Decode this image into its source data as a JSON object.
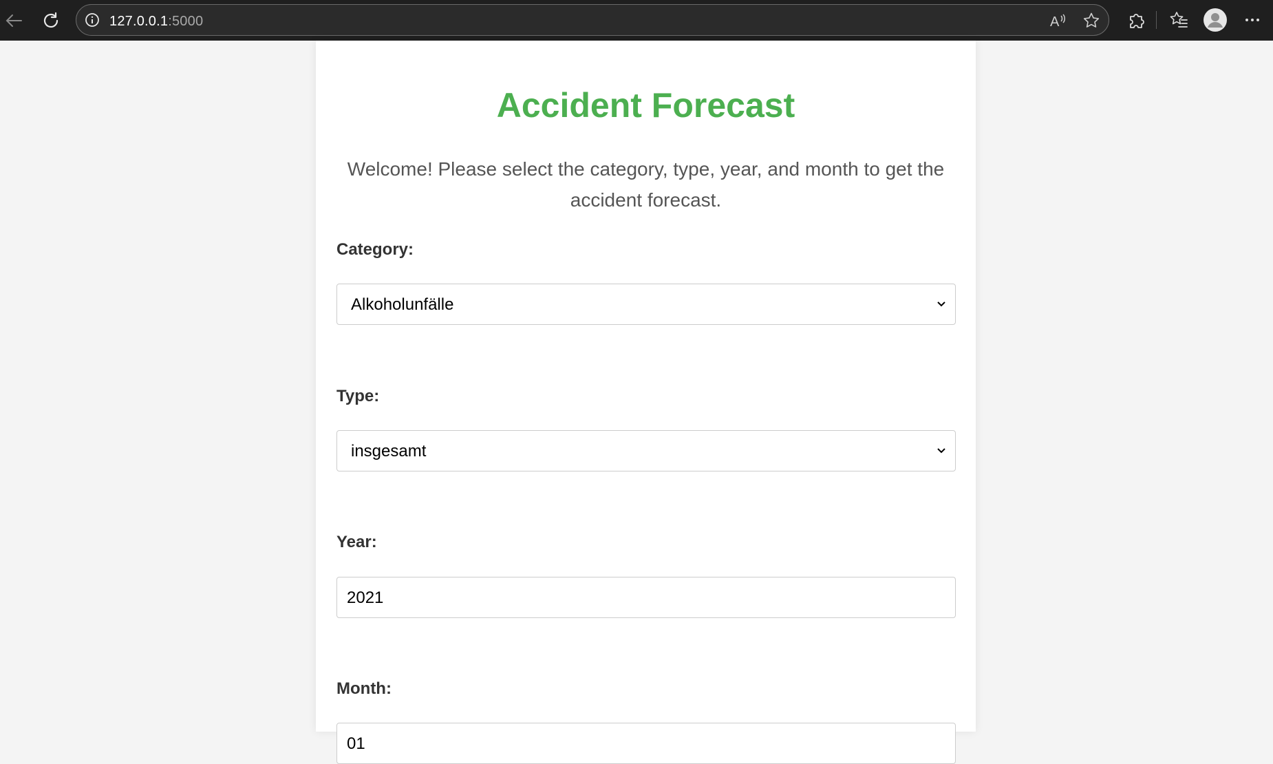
{
  "browser": {
    "host": "127.0.0.1",
    "port": ":5000"
  },
  "page": {
    "title": "Accident Forecast",
    "intro": "Welcome! Please select the category, type, year, and month to get the accident forecast.",
    "accent_color": "#4caf50"
  },
  "form": {
    "category_label": "Category:",
    "category_value": "Alkoholunfälle",
    "type_label": "Type:",
    "type_value": "insgesamt",
    "year_label": "Year:",
    "year_value": "2021",
    "month_label": "Month:",
    "month_value": "01"
  },
  "icons": {
    "back": "back-arrow-icon",
    "refresh": "refresh-icon",
    "info": "info-icon",
    "read_aloud": "read-aloud-icon",
    "favorite": "star-icon",
    "extensions": "puzzle-icon",
    "favorites_bar": "favorites-icon",
    "profile": "profile-icon",
    "menu": "more-icon"
  }
}
